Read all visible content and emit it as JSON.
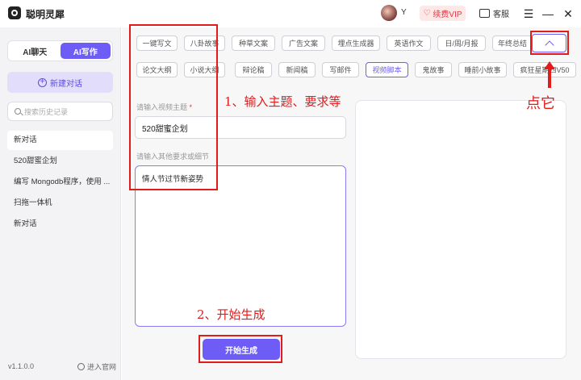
{
  "app": {
    "title": "聪明灵犀"
  },
  "topbar": {
    "username": "Y",
    "vip_label": "续费VIP",
    "service_label": "客服"
  },
  "sidebar": {
    "modes": [
      "AI聊天",
      "AI写作"
    ],
    "active_mode": "AI写作",
    "new_chat_label": "新建对话",
    "search_placeholder": "搜索历史记录",
    "history": [
      "新对话",
      "520甜蜜企划",
      "编写 Mongodb程序，使用 ...",
      "扫拖一体机",
      "新对话"
    ],
    "version": "v1.1.0.0",
    "official_site": "进入官网"
  },
  "tags": {
    "row1": [
      "一键写文",
      "八卦故事",
      "种草文案",
      "广告文案",
      "埋点生成器",
      "英语作文",
      "日/周/月报",
      "年终总结"
    ],
    "row2": [
      "论文大纲",
      "小说大纲",
      "辩论稿",
      "新闻稿",
      "写邮件",
      "视频脚本",
      "鬼故事",
      "睡前小故事",
      "疯狂星期四V50"
    ],
    "active": "视频脚本"
  },
  "form": {
    "topic_label": "请输入视频主题",
    "topic_required_mark": "*",
    "topic_value": "520甜蜜企划",
    "detail_label": "请输入其他要求或细节",
    "detail_value": "情人节过节新姿势",
    "generate_label": "开始生成"
  },
  "annotations": {
    "step1": "1、输入主题、要求等",
    "step2": "2、开始生成",
    "click_hint": "点它"
  },
  "colors": {
    "accent": "#6d5cf5",
    "annotation": "#e21b1b",
    "vip": "#e2373f"
  }
}
